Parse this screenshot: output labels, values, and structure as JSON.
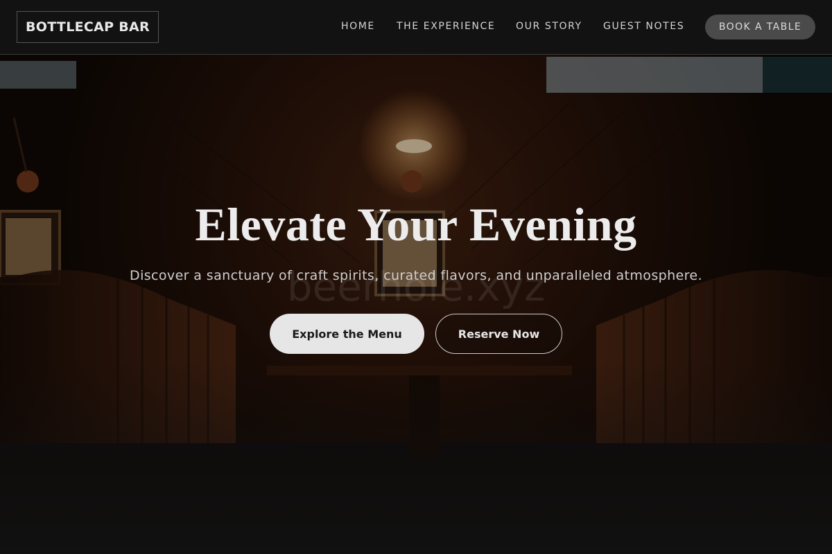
{
  "brand": {
    "name": "BOTTLECAP BAR"
  },
  "nav": {
    "items": [
      {
        "label": "HOME"
      },
      {
        "label": "THE EXPERIENCE"
      },
      {
        "label": "OUR STORY"
      },
      {
        "label": "GUEST NOTES"
      }
    ],
    "cta_label": "BOOK A TABLE"
  },
  "hero": {
    "title": "Elevate Your Evening",
    "subtitle": "Discover a sanctuary of craft spirits, curated flavors, and unparalleled atmosphere.",
    "primary_button": "Explore the Menu",
    "secondary_button": "Reserve Now",
    "watermark": "beerhole.xyz"
  },
  "colors": {
    "background": "#121212",
    "wood": "#3a1c0e",
    "lamp": "#ffd9a0",
    "button_primary_bg": "#e6e6e6",
    "cta_bg": "#4a4a4a"
  }
}
